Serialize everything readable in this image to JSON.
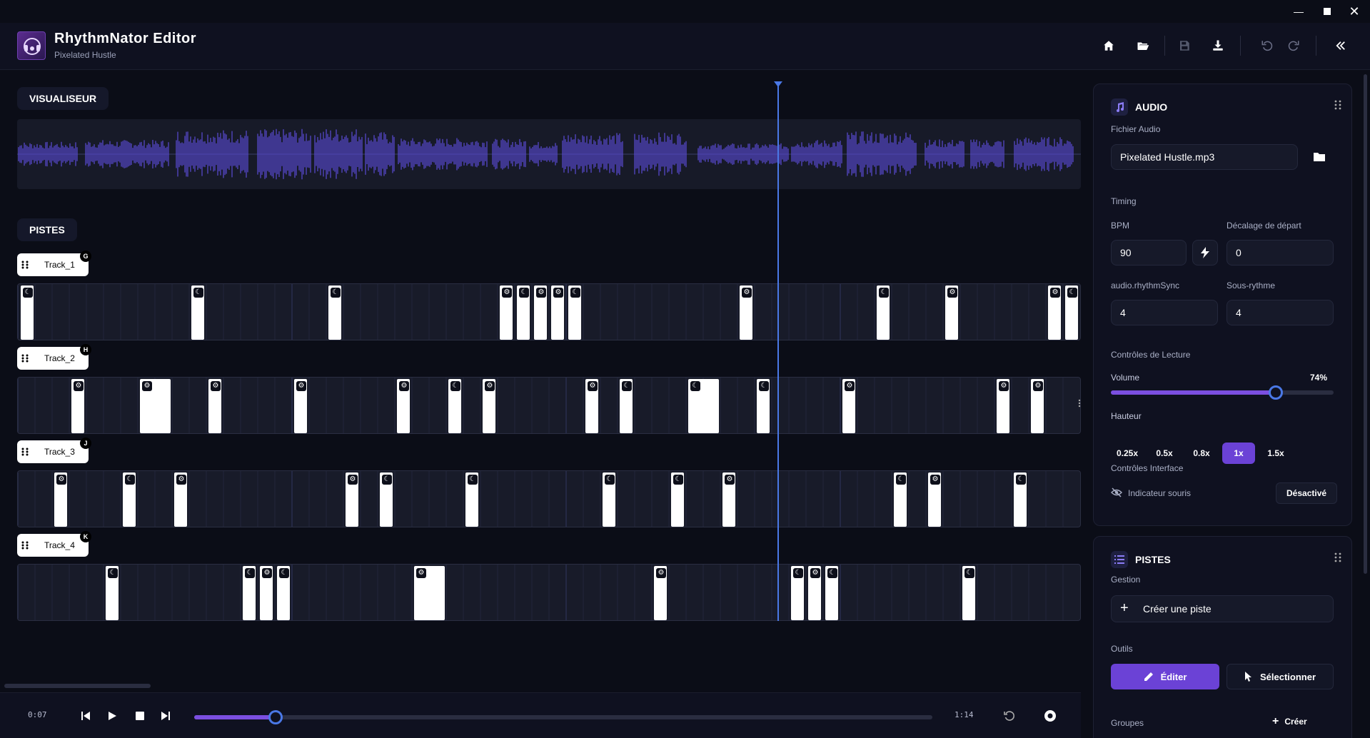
{
  "app": {
    "title": "RhythmNator Editor",
    "subtitle": "Pixelated Hustle"
  },
  "window_controls": [
    "minimize",
    "maximize",
    "close"
  ],
  "header_actions": [
    "home-icon",
    "folder-open-icon",
    "save-icon",
    "download-icon",
    "undo-icon",
    "redo-icon",
    "collapse-panel-icon"
  ],
  "visualiseur": {
    "label": "VISUALISEUR"
  },
  "pistes": {
    "label": "PISTES"
  },
  "tracks": [
    {
      "name": "Track_1",
      "key": "G"
    },
    {
      "name": "Track_2",
      "key": "H"
    },
    {
      "name": "Track_3",
      "key": "J"
    },
    {
      "name": "Track_4",
      "key": "K"
    }
  ],
  "transport": {
    "current_time": "0:07",
    "total_time": "1:14",
    "progress": 0.11
  },
  "audio_panel": {
    "title": "AUDIO",
    "file_label": "Fichier Audio",
    "file_value": "Pixelated Hustle.mp3",
    "timing_label": "Timing",
    "bpm_label": "BPM",
    "bpm_value": "90",
    "offset_label": "Décalage de départ",
    "offset_value": "0",
    "rhythm_label": "audio.rhythmSync",
    "rhythm_value": "4",
    "subrhythm_label": "Sous-rythme",
    "subrhythm_value": "4",
    "playback_label": "Contrôles de Lecture",
    "volume_label": "Volume",
    "volume_value": "74%",
    "volume_level": 0.74,
    "pitch_label": "Hauteur",
    "pitch_options": [
      "0.25x",
      "0.5x",
      "0.8x",
      "1x",
      "1.5x"
    ],
    "pitch_selected": "1x",
    "interface_label": "Contrôles Interface",
    "mouse_indicator_label": "Indicateur souris",
    "mouse_indicator_state": "Désactivé"
  },
  "tracks_panel": {
    "title": "PISTES",
    "gestion_label": "Gestion",
    "create_track": "Créer une piste",
    "tools_label": "Outils",
    "edit_label": "Éditer",
    "select_label": "Sélectionner",
    "groups_label": "Groupes",
    "create_group": "Créer"
  },
  "colors": {
    "accent": "#6b42d6",
    "playhead": "#4a78e6",
    "waveform": "#5a4bd6",
    "background": "#0b0d17"
  }
}
